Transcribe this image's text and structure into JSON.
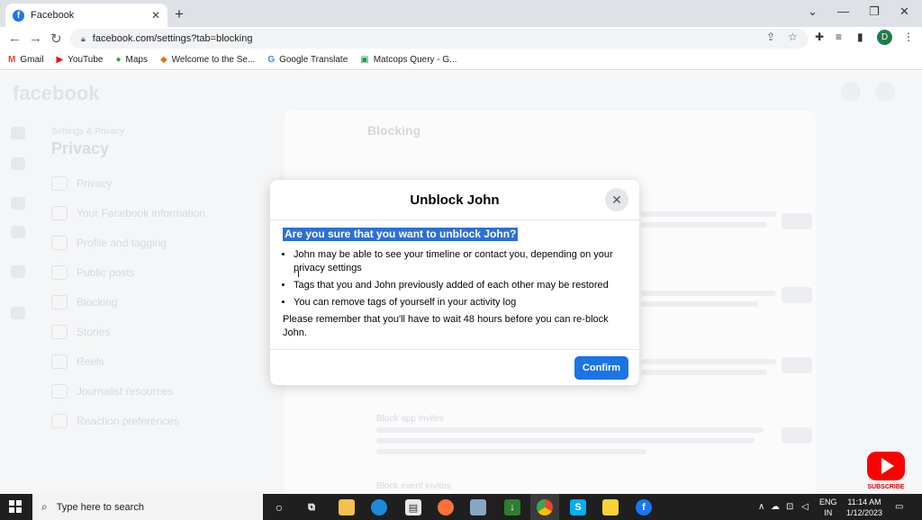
{
  "browser": {
    "tab_title": "Facebook",
    "tab_close": "✕",
    "new_tab": "+",
    "url": "facebook.com/settings?tab=blocking",
    "profile_initial": "D",
    "window_controls": {
      "dropdown": "⌄",
      "minimize": "—",
      "restore": "❐",
      "close": "✕"
    }
  },
  "bookmarks": [
    {
      "label": "Gmail",
      "icon": "M",
      "color": "#ea4335"
    },
    {
      "label": "YouTube",
      "icon": "▶",
      "color": "#ff0000"
    },
    {
      "label": "Maps",
      "icon": "●",
      "color": "#34a853"
    },
    {
      "label": "Welcome to the Se...",
      "icon": "◆",
      "color": "#e8710a"
    },
    {
      "label": "Google Translate",
      "icon": "G",
      "color": "#4285f4"
    },
    {
      "label": "Matcops Query - G...",
      "icon": "▣",
      "color": "#0f9d58"
    }
  ],
  "page": {
    "logo": "facebook",
    "left_small": "Settings & Privacy",
    "left_title": "Privacy",
    "nav": [
      "Privacy",
      "Your Facebook information",
      "Profile and tagging",
      "Public posts",
      "Blocking",
      "Stories",
      "Reels",
      "Journalist resources",
      "Reaction preferences"
    ],
    "section_title": "Blocking",
    "block_apps": "Block app invites",
    "block_more": "Block event invites"
  },
  "modal": {
    "title": "Unblock John",
    "close": "✕",
    "question": "Are you sure that you want to unblock John?",
    "bullets": [
      "John may be able to see your timeline or contact you, depending on your privacy settings",
      "Tags that you and John previously added of each other may be restored",
      "You can remove tags of yourself in your activity log"
    ],
    "note": "Please remember that you'll have to wait 48 hours before you can re-block John.",
    "confirm": "Confirm"
  },
  "overlay": {
    "subscribe": "SUBSCRIBE"
  },
  "taskbar": {
    "search_placeholder": "Type here to search",
    "lang_1": "ENG",
    "lang_2": "IN",
    "time": "11:14 AM",
    "date": "1/12/2023"
  }
}
